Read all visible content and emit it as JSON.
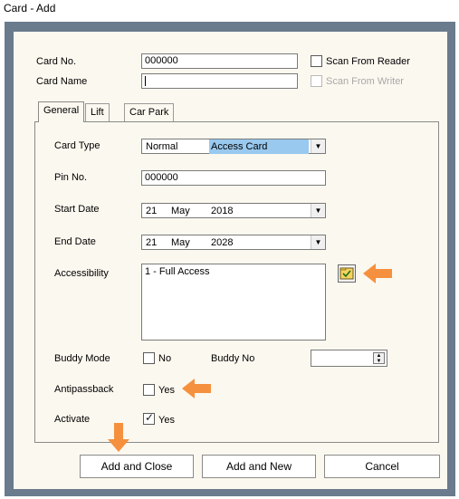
{
  "window": {
    "title": "Card - Add"
  },
  "card": {
    "card_no_label": "Card No.",
    "card_no_value": "000000",
    "card_name_label": "Card Name",
    "card_name_value": "",
    "scan_reader_label": "Scan From Reader",
    "scan_writer_label": "Scan From Writer"
  },
  "tabs": [
    {
      "label": "General",
      "active": true
    },
    {
      "label": "Lift"
    },
    {
      "label": "Car Park"
    }
  ],
  "general": {
    "card_type_label": "Card Type",
    "card_type_value_a": "Normal",
    "card_type_value_b": "Access Card",
    "pin_label": "Pin No.",
    "pin_value": "000000",
    "start_label": "Start Date",
    "start_day": "21",
    "start_month": "May",
    "start_year": "2018",
    "end_label": "End Date",
    "end_day": "21",
    "end_month": "May",
    "end_year": "2028",
    "access_label": "Accessibility",
    "access_items": [
      "1 - Full Access"
    ],
    "buddy_mode_label": "Buddy Mode",
    "buddy_mode_value": "No",
    "buddy_no_label": "Buddy No",
    "buddy_no_value": "",
    "antipassback_label": "Antipassback",
    "antipassback_value": "Yes",
    "activate_label": "Activate",
    "activate_value": "Yes",
    "activate_checked": true
  },
  "buttons": {
    "add_close": "Add and Close",
    "add_new": "Add and New",
    "cancel": "Cancel"
  },
  "colors": {
    "frame": "#697b8d",
    "dialog_bg": "#fbf8ef",
    "highlight": "#99c9ef",
    "annotation_arrow": "#f5913e"
  },
  "icons": {
    "accessibility_picker": "folder-check-icon",
    "annotation": "orange-arrow-icon"
  }
}
